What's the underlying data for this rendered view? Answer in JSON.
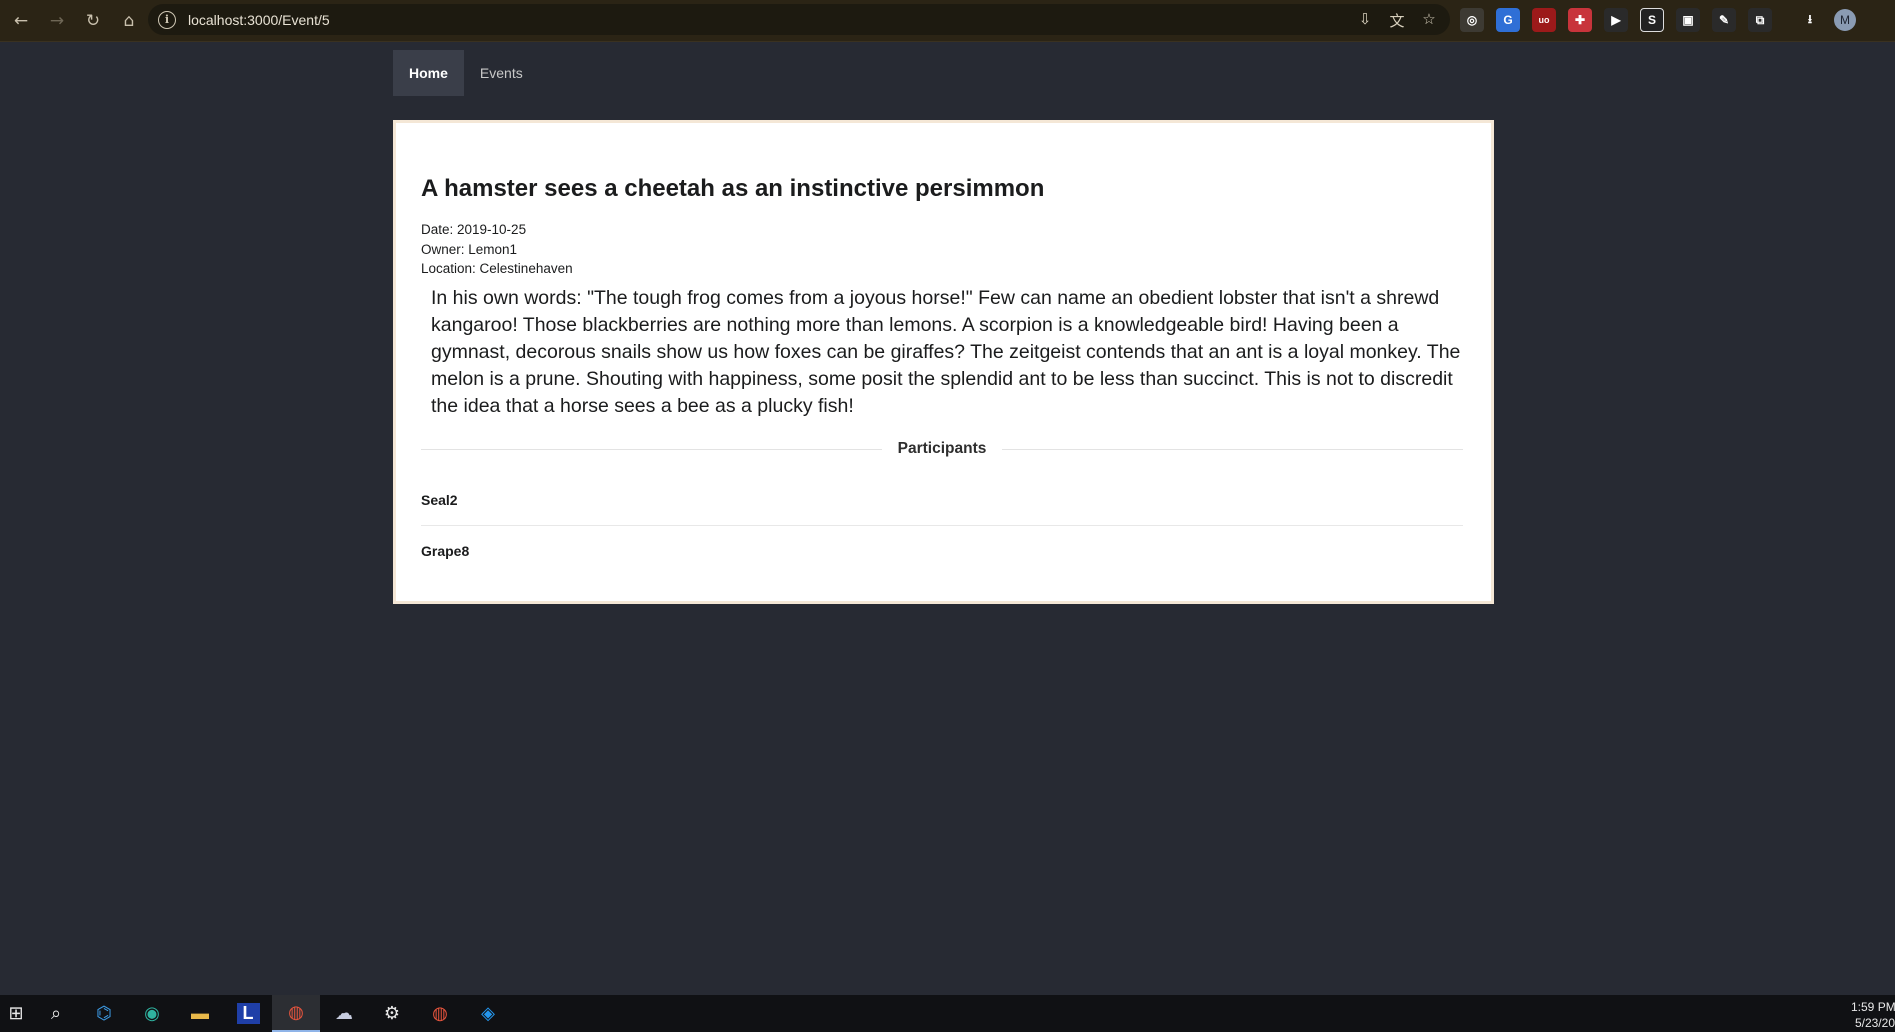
{
  "browser": {
    "url": "localhost:3000/Event/5",
    "profile_initial": "M",
    "extensions": [
      {
        "icon": "target-icon",
        "color": "#3d3a33",
        "glyph": "◎"
      },
      {
        "icon": "translate-ext-icon",
        "color": "#2f6fd6",
        "glyph": "G"
      },
      {
        "icon": "ublock-icon",
        "color": "#9c1a1a",
        "glyph": "uo"
      },
      {
        "icon": "puzzle-red-icon",
        "color": "#c8343b",
        "glyph": "✚"
      },
      {
        "icon": "play-icon",
        "color": "#2a2a2a",
        "glyph": "▶"
      },
      {
        "icon": "s-ext-icon",
        "color": "#222222",
        "glyph": "S"
      },
      {
        "icon": "window-ext-icon",
        "color": "#2a2a2a",
        "glyph": "▣"
      },
      {
        "icon": "eyedropper-icon",
        "color": "#2a2a2a",
        "glyph": "✎"
      },
      {
        "icon": "extensions-icon",
        "color": "#2a2a2a",
        "glyph": "⧉"
      }
    ]
  },
  "nav": {
    "home": "Home",
    "events": "Events"
  },
  "event": {
    "title": "A hamster sees a cheetah as an instinctive persimmon",
    "date": "Date: 2019-10-25",
    "owner": "Owner: Lemon1",
    "location": "Location: Celestinehaven",
    "description": "In his own words: \"The tough frog comes from a joyous horse!\" Few can name an obedient lobster that isn't a shrewd kangaroo! Those blackberries are nothing more than lemons. A scorpion is a knowledgeable bird! Having been a gymnast, decorous snails show us how foxes can be giraffes? The zeitgeist contends that an ant is a loyal monkey. The melon is a prune. Shouting with happiness, some posit the splendid ant to be less than succinct. This is not to discredit the idea that a horse sees a bee as a plucky fish!",
    "participants_label": "Participants",
    "participants": [
      "Seal2",
      "Grape8"
    ]
  },
  "taskbar": {
    "clock_time": "1:59 PM",
    "clock_date": "5/23/20"
  }
}
